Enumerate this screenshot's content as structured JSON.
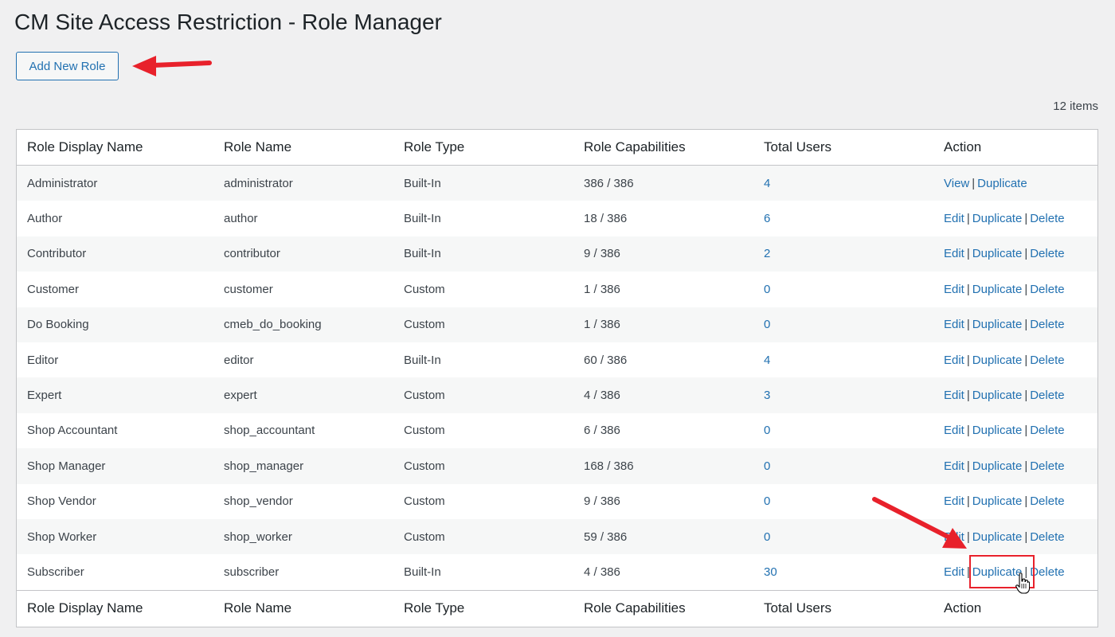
{
  "page": {
    "title": "CM Site Access Restriction - Role Manager",
    "add_button_label": "Add New Role",
    "items_count": "12 items"
  },
  "table": {
    "columns": [
      "Role Display Name",
      "Role Name",
      "Role Type",
      "Role Capabilities",
      "Total Users",
      "Action"
    ],
    "rows": [
      {
        "display_name": "Administrator",
        "name": "administrator",
        "type": "Built-In",
        "capabilities": "386 / 386",
        "users": "4",
        "actions": [
          "View",
          "Duplicate"
        ]
      },
      {
        "display_name": "Author",
        "name": "author",
        "type": "Built-In",
        "capabilities": "18 / 386",
        "users": "6",
        "actions": [
          "Edit",
          "Duplicate",
          "Delete"
        ]
      },
      {
        "display_name": "Contributor",
        "name": "contributor",
        "type": "Built-In",
        "capabilities": "9 / 386",
        "users": "2",
        "actions": [
          "Edit",
          "Duplicate",
          "Delete"
        ]
      },
      {
        "display_name": "Customer",
        "name": "customer",
        "type": "Custom",
        "capabilities": "1 / 386",
        "users": "0",
        "actions": [
          "Edit",
          "Duplicate",
          "Delete"
        ]
      },
      {
        "display_name": "Do Booking",
        "name": "cmeb_do_booking",
        "type": "Custom",
        "capabilities": "1 / 386",
        "users": "0",
        "actions": [
          "Edit",
          "Duplicate",
          "Delete"
        ]
      },
      {
        "display_name": "Editor",
        "name": "editor",
        "type": "Built-In",
        "capabilities": "60 / 386",
        "users": "4",
        "actions": [
          "Edit",
          "Duplicate",
          "Delete"
        ]
      },
      {
        "display_name": "Expert",
        "name": "expert",
        "type": "Custom",
        "capabilities": "4 / 386",
        "users": "3",
        "actions": [
          "Edit",
          "Duplicate",
          "Delete"
        ]
      },
      {
        "display_name": "Shop Accountant",
        "name": "shop_accountant",
        "type": "Custom",
        "capabilities": "6 / 386",
        "users": "0",
        "actions": [
          "Edit",
          "Duplicate",
          "Delete"
        ]
      },
      {
        "display_name": "Shop Manager",
        "name": "shop_manager",
        "type": "Custom",
        "capabilities": "168 / 386",
        "users": "0",
        "actions": [
          "Edit",
          "Duplicate",
          "Delete"
        ]
      },
      {
        "display_name": "Shop Vendor",
        "name": "shop_vendor",
        "type": "Custom",
        "capabilities": "9 / 386",
        "users": "0",
        "actions": [
          "Edit",
          "Duplicate",
          "Delete"
        ]
      },
      {
        "display_name": "Shop Worker",
        "name": "shop_worker",
        "type": "Custom",
        "capabilities": "59 / 386",
        "users": "0",
        "actions": [
          "Edit",
          "Duplicate",
          "Delete"
        ]
      },
      {
        "display_name": "Subscriber",
        "name": "subscriber",
        "type": "Built-In",
        "capabilities": "4 / 386",
        "users": "30",
        "actions": [
          "Edit",
          "Duplicate",
          "Delete"
        ]
      }
    ],
    "action_separator": "|"
  },
  "annotations": {
    "arrow_color": "#e8212b",
    "highlight_color": "#e8212b",
    "link_color": "#2271b1"
  }
}
